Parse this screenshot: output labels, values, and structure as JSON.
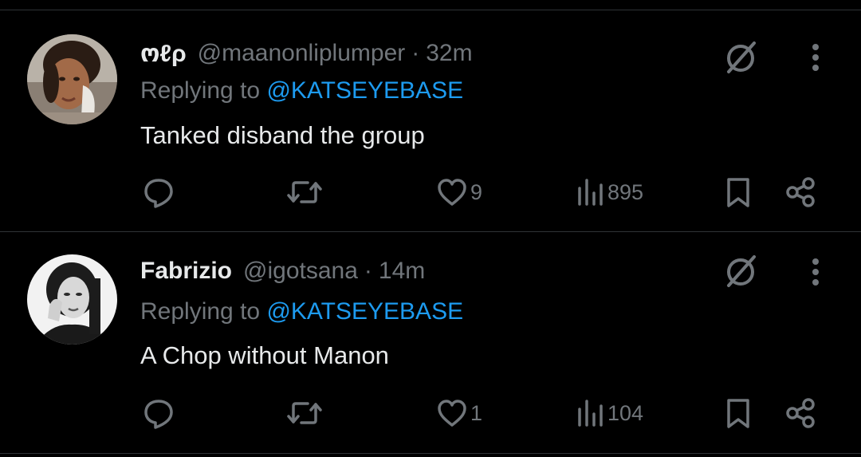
{
  "colors": {
    "background": "#000000",
    "primary_text": "#e7e9ea",
    "secondary_text": "#71767b",
    "mention": "#1d9bf0",
    "divider": "#2f3336"
  },
  "tweets": [
    {
      "display_name": "ო&#x10E4;",
      "display_name_text": "ოℓρ",
      "handle": "@maanonliplumper",
      "separator": "·",
      "time": "32m",
      "replying_prefix": "Replying to",
      "replying_to": "@KATSEYEBASE",
      "text": "Tanked disband the group",
      "likes": "9",
      "views": "895",
      "avatar_icon": "profile-photo"
    },
    {
      "display_name_text": "Fabrizio",
      "handle": "@igotsana",
      "separator": "·",
      "time": "14m",
      "replying_prefix": "Replying to",
      "replying_to": "@KATSEYEBASE",
      "text": "A Chop without Manon",
      "likes": "1",
      "views": "104",
      "avatar_icon": "profile-photo"
    }
  ],
  "icons": {
    "reply": "reply-icon",
    "retweet": "retweet-icon",
    "like": "heart-icon",
    "views": "views-icon",
    "bookmark": "bookmark-icon",
    "share": "share-icon",
    "grok": "grok-icon",
    "more": "more-icon"
  }
}
